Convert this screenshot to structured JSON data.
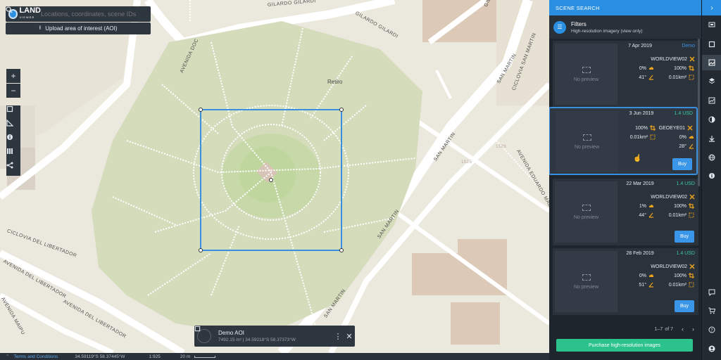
{
  "map": {
    "search_placeholder": "Locations, coordinates, scene IDs",
    "upload_label": "Upload area of interest (AOI)",
    "logo_text": "LAND",
    "logo_sub": "VIEWER",
    "zoom_in": "+",
    "zoom_out": "−",
    "labels": {
      "gilardo_1": "GILARDO GILARDI",
      "gilardo_2": "GILARDO GILARDI",
      "gilardo_3": "GILARDO GILARDI",
      "avenida_doc": "AVENIDA DOC",
      "retiro": "Retiro",
      "san_martin_1": "SAN MARTIN",
      "san_martin_2": "SAN MARTIN",
      "san_martin_3": "SAN MARTIN",
      "san_martin_4": "SAN MARTIN",
      "ciclovia_1": "CICLOVIA SAN MARTIN",
      "ciclovia_2": "CICLOVIA DEL LIBERTADOR",
      "eduardo": "AVENIDA EDUARDO MADERO",
      "libertador_1": "AVENIDA DEL LIBERTADOR",
      "libertador_2": "AVENIDA DEL LIBERTADOR",
      "maipu": "AVENIDA MAIPU",
      "num_1526": "1526",
      "num_1525": "1525"
    },
    "aoi": {
      "name": "Demo AOI",
      "meta": "7492.15 m² | 34.59218°S 58.37373°W",
      "more": "⋮",
      "close": "✕"
    },
    "status": {
      "terms": "Terms and Conditions",
      "coords": "34.59119°S 58.37445°W",
      "scale": "1:925",
      "distance": "20 m"
    }
  },
  "panel": {
    "title": "SCENE SEARCH",
    "collapse": "›",
    "filters_title": "Filters",
    "filters_sub": "High-resolution imagery (view only)",
    "no_preview": "No preview",
    "buy_label": "Buy",
    "pager": {
      "range": "1–7",
      "of": "of 7",
      "prev": "‹",
      "next": "›"
    },
    "purchase_label": "Purchase high-resolution images",
    "scenes": [
      {
        "date": "7 Apr 2019",
        "price": "Demo",
        "satellite": "WORLDVIEW02",
        "cloud": "0%",
        "coverage": "100%",
        "angle": "41°",
        "area": "0.01km²"
      },
      {
        "date": "3 Jun 2019",
        "price": "1.4 USD",
        "satellite": "GEOEYE01",
        "cloud": "0%",
        "coverage": "100%",
        "angle": "28°",
        "area": "0.01km²"
      },
      {
        "date": "22 Mar 2019",
        "price": "1.4 USD",
        "satellite": "WORLDVIEW02",
        "cloud": "1%",
        "coverage": "100%",
        "angle": "44°",
        "area": "0.01km²"
      },
      {
        "date": "28 Feb 2019",
        "price": "1.4 USD",
        "satellite": "WORLDVIEW02",
        "cloud": "0%",
        "coverage": "100%",
        "angle": "51°",
        "area": "0.01km²"
      }
    ]
  },
  "colors": {
    "accent": "#2a8fe0",
    "price": "#3bc8a0",
    "purchase": "#2bc28b",
    "icon_orange": "#e9a21d"
  }
}
